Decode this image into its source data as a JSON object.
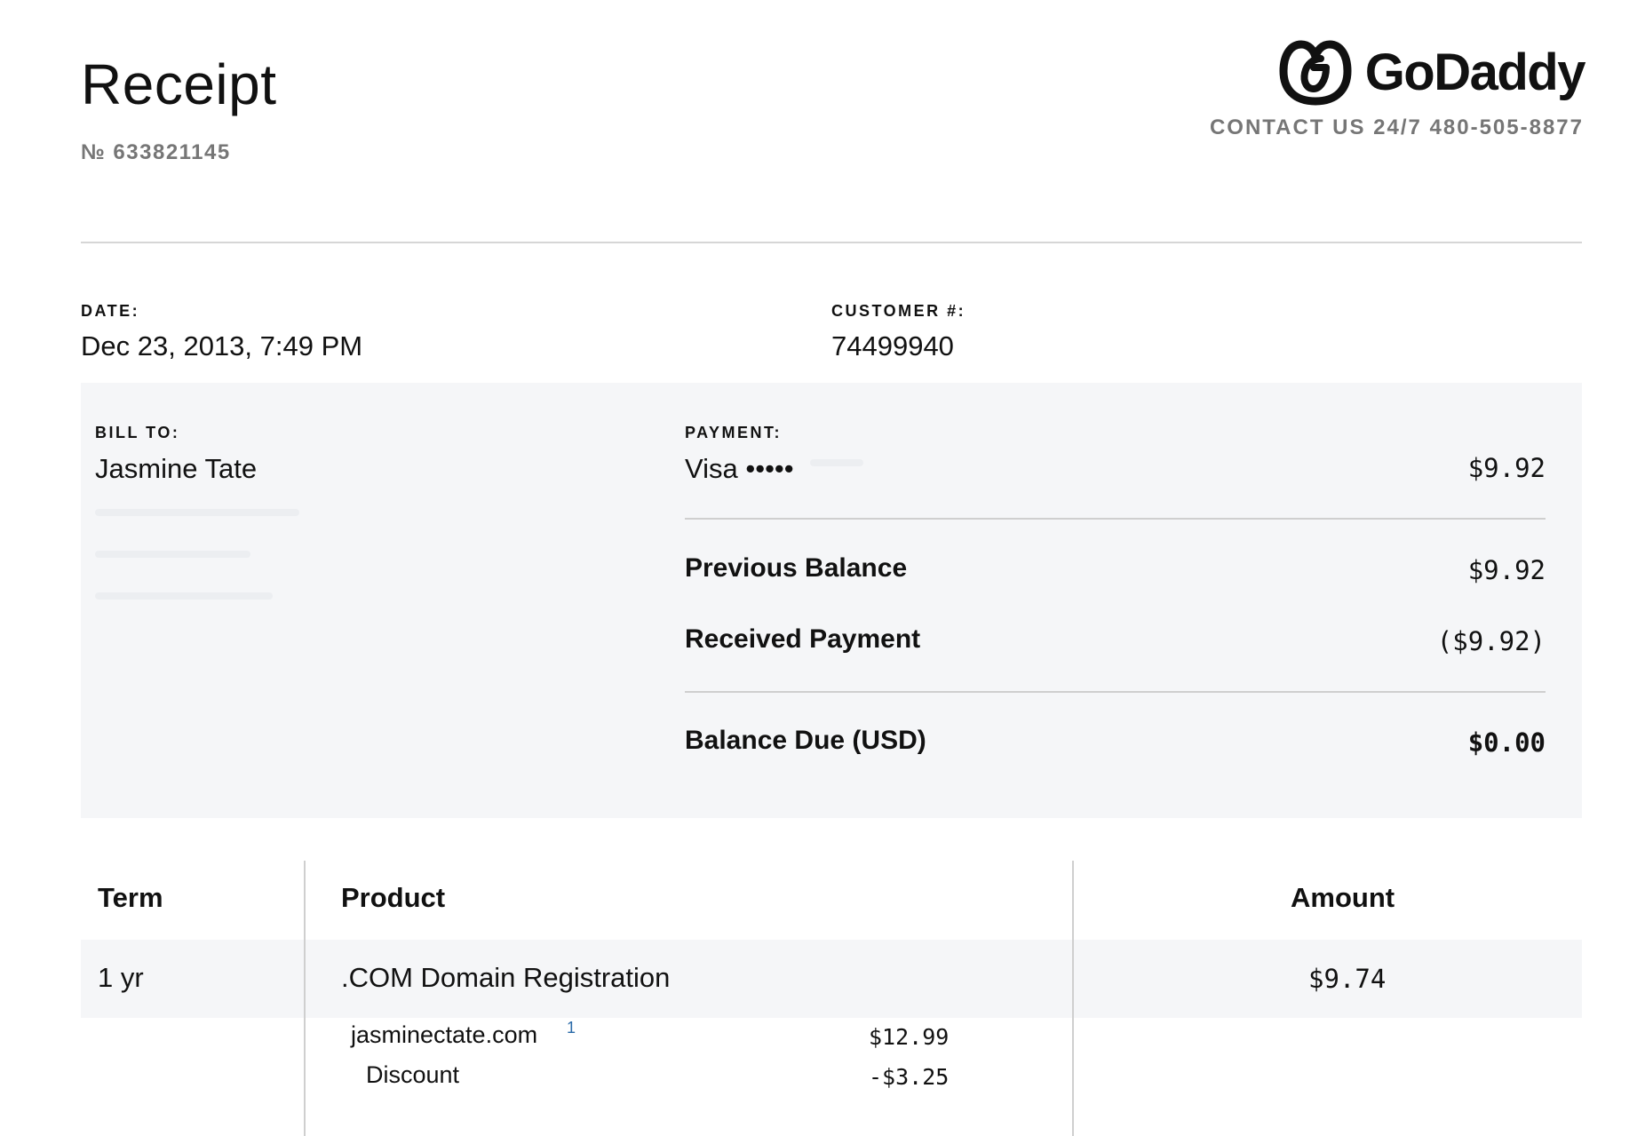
{
  "header": {
    "title": "Receipt",
    "receipt_number": "№ 633821145",
    "brand": "GoDaddy",
    "contact": "CONTACT US 24/7 480-505-8877"
  },
  "meta": {
    "date_label": "DATE:",
    "date_value": "Dec 23, 2013, 7:49 PM",
    "customer_label": "CUSTOMER #:",
    "customer_value": "74499940"
  },
  "billing": {
    "bill_to_label": "BILL TO:",
    "name": "Jasmine Tate",
    "payment_label": "PAYMENT:",
    "payment_method": "Visa •••••",
    "payment_amount": "$9.92",
    "previous_balance_label": "Previous Balance",
    "previous_balance": "$9.92",
    "received_payment_label": "Received Payment",
    "received_payment": "($9.92)",
    "balance_due_label": "Balance Due (USD)",
    "balance_due": "$0.00"
  },
  "table": {
    "headers": {
      "term": "Term",
      "product": "Product",
      "amount": "Amount"
    },
    "row": {
      "term": "1 yr",
      "product": ".COM Domain Registration",
      "amount": "$9.74",
      "domain": "jasminectate.com",
      "footnote": "1",
      "domain_price": "$12.99",
      "discount_label": "Discount",
      "discount_amount": "-$3.25"
    }
  }
}
